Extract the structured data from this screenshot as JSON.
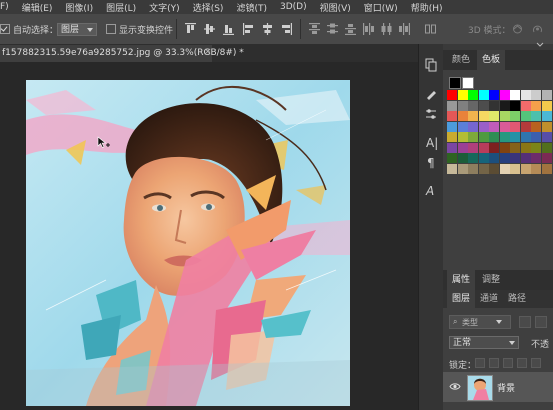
{
  "menu": [
    "F)",
    "编辑(E)",
    "图像(I)",
    "图层(L)",
    "文字(Y)",
    "选择(S)",
    "滤镜(T)",
    "3D(D)",
    "视图(V)",
    "窗口(W)",
    "帮助(H)"
  ],
  "options": {
    "auto_select_label": "自动选择：",
    "auto_select_value": "图层",
    "show_transform_label": "显示变换控件",
    "mode_3d_label": "3D 模式："
  },
  "document_tab": "f157882315.59e76a9285752.jpg @ 33.3%(RGB/8#) *",
  "color_panel": {
    "tabs": [
      "颜色",
      "色板"
    ],
    "swatch_rows": [
      [
        "#ff0000",
        "#ffff00",
        "#00ff00",
        "#00ffff",
        "#0000ff",
        "#ff00ff",
        "#ffffff",
        "#e6e6e6",
        "#cccccc",
        "#b3b3b3"
      ],
      [
        "#999999",
        "#808080",
        "#666666",
        "#4d4d4d",
        "#333333",
        "#1a1a1a",
        "#000000",
        "#f26b6b",
        "#f5a04b",
        "#f2c94c"
      ],
      [
        "#e45757",
        "#e9823a",
        "#f0b44e",
        "#f6d862",
        "#dfe86a",
        "#a8d862",
        "#7ccf68",
        "#55c47b",
        "#4cc0ad",
        "#4bb7d4"
      ],
      [
        "#4b9bdc",
        "#5a7fd8",
        "#7666d0",
        "#9a5fc9",
        "#c05cba",
        "#d95b98",
        "#e05873",
        "#b33b3b",
        "#b8621f",
        "#bf8f2c"
      ],
      [
        "#c9ab2f",
        "#b3bd34",
        "#7ea93a",
        "#4f9a40",
        "#2f8d54",
        "#259880",
        "#2491a7",
        "#2f75ae",
        "#3b5fae",
        "#574ea8"
      ],
      [
        "#7b46a3",
        "#9b4096",
        "#b03f7b",
        "#b83c5b",
        "#7d2020",
        "#7f4311",
        "#84621a",
        "#8a7615",
        "#7b8419",
        "#526f1d"
      ],
      [
        "#2e6322",
        "#1c5d39",
        "#17685b",
        "#16647a",
        "#1c4f7d",
        "#263f7e",
        "#3a347a",
        "#552f77",
        "#6d2c6b",
        "#7b2b54"
      ],
      [
        "#c6b99a",
        "#a99a7a",
        "#8d7e5f",
        "#736447",
        "#5b4c33",
        "#e3d2b3",
        "#d9c08f",
        "#c7a470",
        "#b58b57",
        "#a1733f"
      ]
    ]
  },
  "layers_panel": {
    "tabs": [
      "属性",
      "调整"
    ],
    "sub_tabs": [
      "图层",
      "通道",
      "路径"
    ],
    "filter_placeholder": "类型",
    "blend_mode": "正常",
    "opacity_label": "不透",
    "lock_label": "锁定：",
    "layer_name": "背景"
  },
  "colors": {
    "menubar": "#3a3a3a",
    "optionsbar": "#484848",
    "panel": "#3a3a3a",
    "canvas_bg": "#282828"
  }
}
